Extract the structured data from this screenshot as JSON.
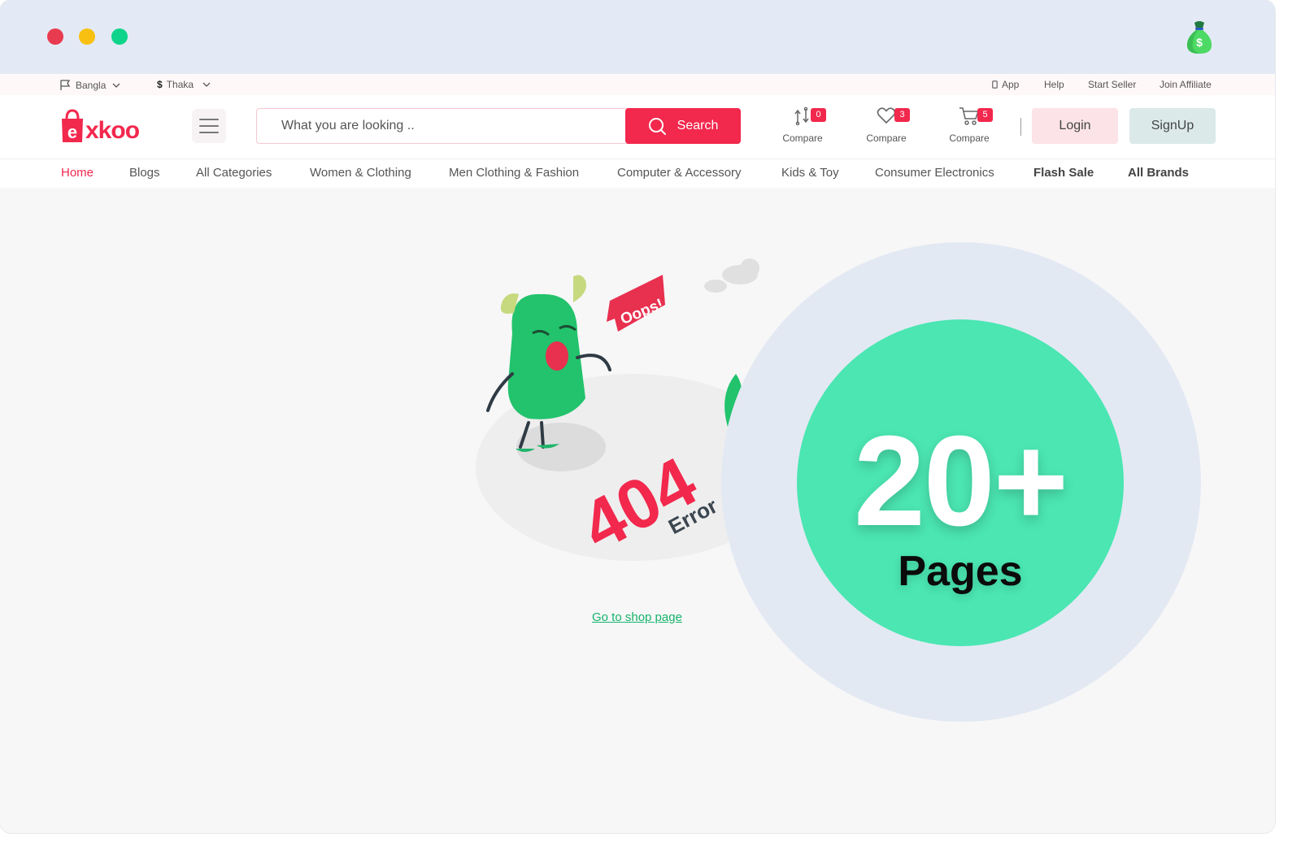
{
  "window_controls": {
    "close_color": "#e93b4f",
    "minimize_color": "#f8c011",
    "maximize_color": "#0fd48a"
  },
  "topbar": {
    "language": "Bangla",
    "currency_symbol": "$",
    "currency": "Thaka",
    "links": [
      "App",
      "Help",
      "Start Seller",
      "Join Affiliate"
    ]
  },
  "header": {
    "logo_text": "xkoo",
    "search": {
      "placeholder": "What you are looking ..",
      "button_label": "Search"
    },
    "icons": [
      {
        "icon": "compare-icon",
        "badge": "0",
        "label": "Compare"
      },
      {
        "icon": "heart-icon",
        "badge": "3",
        "label": "Compare"
      },
      {
        "icon": "cart-icon",
        "badge": "5",
        "label": "Compare"
      }
    ],
    "login_label": "Login",
    "signup_label": "SignUp"
  },
  "nav": {
    "items": [
      "Home",
      "Blogs",
      "All Categories",
      "Women & Clothing",
      "Men Clothing & Fashion",
      "Computer & Accessory",
      "Kids & Toy",
      "Consumer Electronics",
      "Flash Sale",
      "All Brands"
    ]
  },
  "error_page": {
    "speech_bubble": "Oops!",
    "code": "404",
    "word": "Error",
    "link_text": "Go to shop page"
  },
  "promo": {
    "number": "20+",
    "label": "Pages"
  },
  "colors": {
    "brand": "#f2284d",
    "accent_green": "#4be6b2",
    "link_green": "#16b36b"
  }
}
